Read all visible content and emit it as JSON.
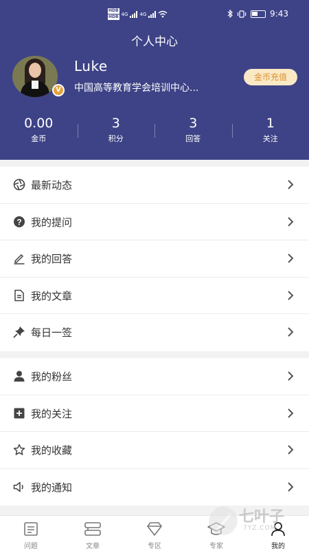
{
  "status_bar": {
    "time": "9:43",
    "network_left_1": "4G",
    "network_left_2": "4G",
    "hd_1": "HD",
    "hd_2": "HD",
    "sim_1": "B",
    "sim_2": "B"
  },
  "header": {
    "title": "个人中心",
    "username": "Luke",
    "organization": "中国高等教育学会培训中心...",
    "badge": "V",
    "coin_button": "金币充值"
  },
  "stats": [
    {
      "value": "0.00",
      "label": "金币"
    },
    {
      "value": "3",
      "label": "积分"
    },
    {
      "value": "3",
      "label": "回答"
    },
    {
      "value": "1",
      "label": "关注"
    }
  ],
  "menu_group_1": [
    {
      "label": "最新动态",
      "icon": "aperture-icon"
    },
    {
      "label": "我的提问",
      "icon": "question-circle-icon"
    },
    {
      "label": "我的回答",
      "icon": "pencil-icon"
    },
    {
      "label": "我的文章",
      "icon": "document-icon"
    },
    {
      "label": "每日一签",
      "icon": "pin-icon"
    }
  ],
  "menu_group_2": [
    {
      "label": "我的粉丝",
      "icon": "person-icon"
    },
    {
      "label": "我的关注",
      "icon": "plus-square-icon"
    },
    {
      "label": "我的收藏",
      "icon": "star-icon"
    },
    {
      "label": "我的通知",
      "icon": "speaker-icon"
    }
  ],
  "tabbar": [
    {
      "label": "问题",
      "icon": "question-list-icon"
    },
    {
      "label": "文章",
      "icon": "article-icon"
    },
    {
      "label": "专区",
      "icon": "diamond-icon"
    },
    {
      "label": "专家",
      "icon": "graduation-cap-icon"
    },
    {
      "label": "我的",
      "icon": "profile-icon",
      "active": true
    }
  ],
  "watermark": {
    "text": "七叶子",
    "sub": "7YZ.COM"
  },
  "colors": {
    "header_bg": "#3e4387",
    "coin_button_bg": "#fbe9c6",
    "coin_button_text": "#d9912f",
    "badge": "#e3a23c"
  }
}
